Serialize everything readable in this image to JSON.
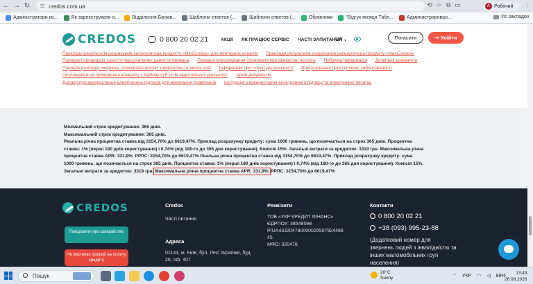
{
  "browser": {
    "url": "credos.com.ua",
    "profile_label": "Робочий",
    "profile_initial": "А",
    "bookmarks": [
      {
        "label": "Адміністратори ко...",
        "color": "#4c8cf5"
      },
      {
        "label": "Як зареєструвати о...",
        "color": "#3b8d5c"
      },
      {
        "label": "Відділення Банків...",
        "color": "#f2a900"
      },
      {
        "label": "Шаблони ответов (...",
        "color": "#6b7280"
      },
      {
        "label": "Шаблони ответов (...",
        "color": "#6b7280"
      },
      {
        "label": "Обмінники",
        "color": "#2bb673"
      },
      {
        "label": "\"Відгук місяця Табл...",
        "color": "#2bb673"
      },
      {
        "label": "Администрирован...",
        "color": "#c0392b"
      }
    ],
    "all_bookmarks_label": "Усі закладки"
  },
  "header": {
    "logo_text": "CREDOS",
    "phone": "0 800 20 02 21",
    "nav": [
      "АКЦІЇ",
      "ЯК ПРАЦЮЄ СЕРВІС",
      "ЧАСТІ ЗАПИТАННЯ"
    ],
    "lang": "UA ⌄",
    "repay_button": "Погасити",
    "login_button": "➔ Увійти"
  },
  "links": [
    [
      "Приклади результатів розрахунків калькулятора продукту «MiniCredos» для повторних клієнтів",
      "Приклади результатів розрахунків калькулятора продукту «MaxiCredos»"
    ],
    [
      "Порядок і процедура захисту персональних даних споживача",
      "Порядок інформування споживача про фінансові послуги",
      "Публічна інформація",
      "Дозвільні документи"
    ],
    [
      "Порядок розгляду звернень споживачів послуг товариства та інших осіб",
      "Інформація про структуру власності",
      "Врегулювання простроченої заборгованості"
    ],
    [
      "Оголошення на проведення конкурсу з відбору суб'єктів аудиторської діяльності",
      "Архів документів"
    ],
    [
      "Договір про використання електронних підписів для виконання правочинів",
      "Інструкція з використання електронного підпису та електронної печатки"
    ]
  ],
  "info": {
    "line1": "Мінімальний строк кредитування: 365 днів.",
    "line2": "Максимальний строк кредитування: 365 днів.",
    "line3": "Реальна річна процентна ставка від 3154,70% до 6619,47%. Приклад розрахунку кредиту: сума 1000 гривень, що позичається на строк 365 днів. Процентна",
    "line4": "ставка: 1% (перші 180 днів користування) і 0,74% (від 180-го до 365 дня користування). Комісія 15%. Загальні витрати за кредитом: 3319 грн. Максимальна річна",
    "line5": "процентна ставка APR: 331,9%. РРПС: 3154,70% до 6619,47% Реальна річна процентна ставка від 3154,70% до 6619,47%. Приклад розрахунку кредиту: сума",
    "line6": "1000 гривень, що позичається на строк 365 днів. Процентна ставка: 1% (перші 180 днів користування) і 0,74% (від 180-го до 365 дня користування). Комісія 15%.",
    "line7_pre": "Загальні витрати за кредитом: 3319 грн. ",
    "line7_highlight": "Максимальна річна процентна ставка APR: 331,9%.",
    "line7_post": " РРПС: 3154,70% до 6619,47%"
  },
  "footer": {
    "logo_text": "CREDOS",
    "btn_report_fraud": "Повідомити про шахрайство",
    "btn_not_enough": "Не вистачає грошей на оплату кредиту",
    "col_credos_title": "Credos",
    "col_credos_link": "Часті питання",
    "col_address_title": "Адреса",
    "address_lines": [
      "01133, м. Київ, бул. Лесі Українки, буд.",
      "26, оф. 407"
    ],
    "col_req_title": "Реквізити",
    "req_lines": [
      "ТОВ «УКР КРЕДИТ ФІНАНС»",
      "ЄДРПОУ: 38548598",
      "Р/UA433204780000026507924489",
      "45",
      "МФО: 320478"
    ],
    "col_contacts_title": "Контакти",
    "phone1": "0 800 20 02 21",
    "phone2": "+38 (093) 995-23-88",
    "contact_note": [
      "(Додатковий номер для",
      "звернень людей з інвалідністю та",
      "інших маломобільних груп",
      "населення)"
    ]
  },
  "taskbar": {
    "search_placeholder": "Пошук",
    "weather_temp": "20°C",
    "weather_desc": "Sunny",
    "lang": "УКР",
    "battery": "88%",
    "time": "13:43",
    "date": "26.08.2026"
  }
}
